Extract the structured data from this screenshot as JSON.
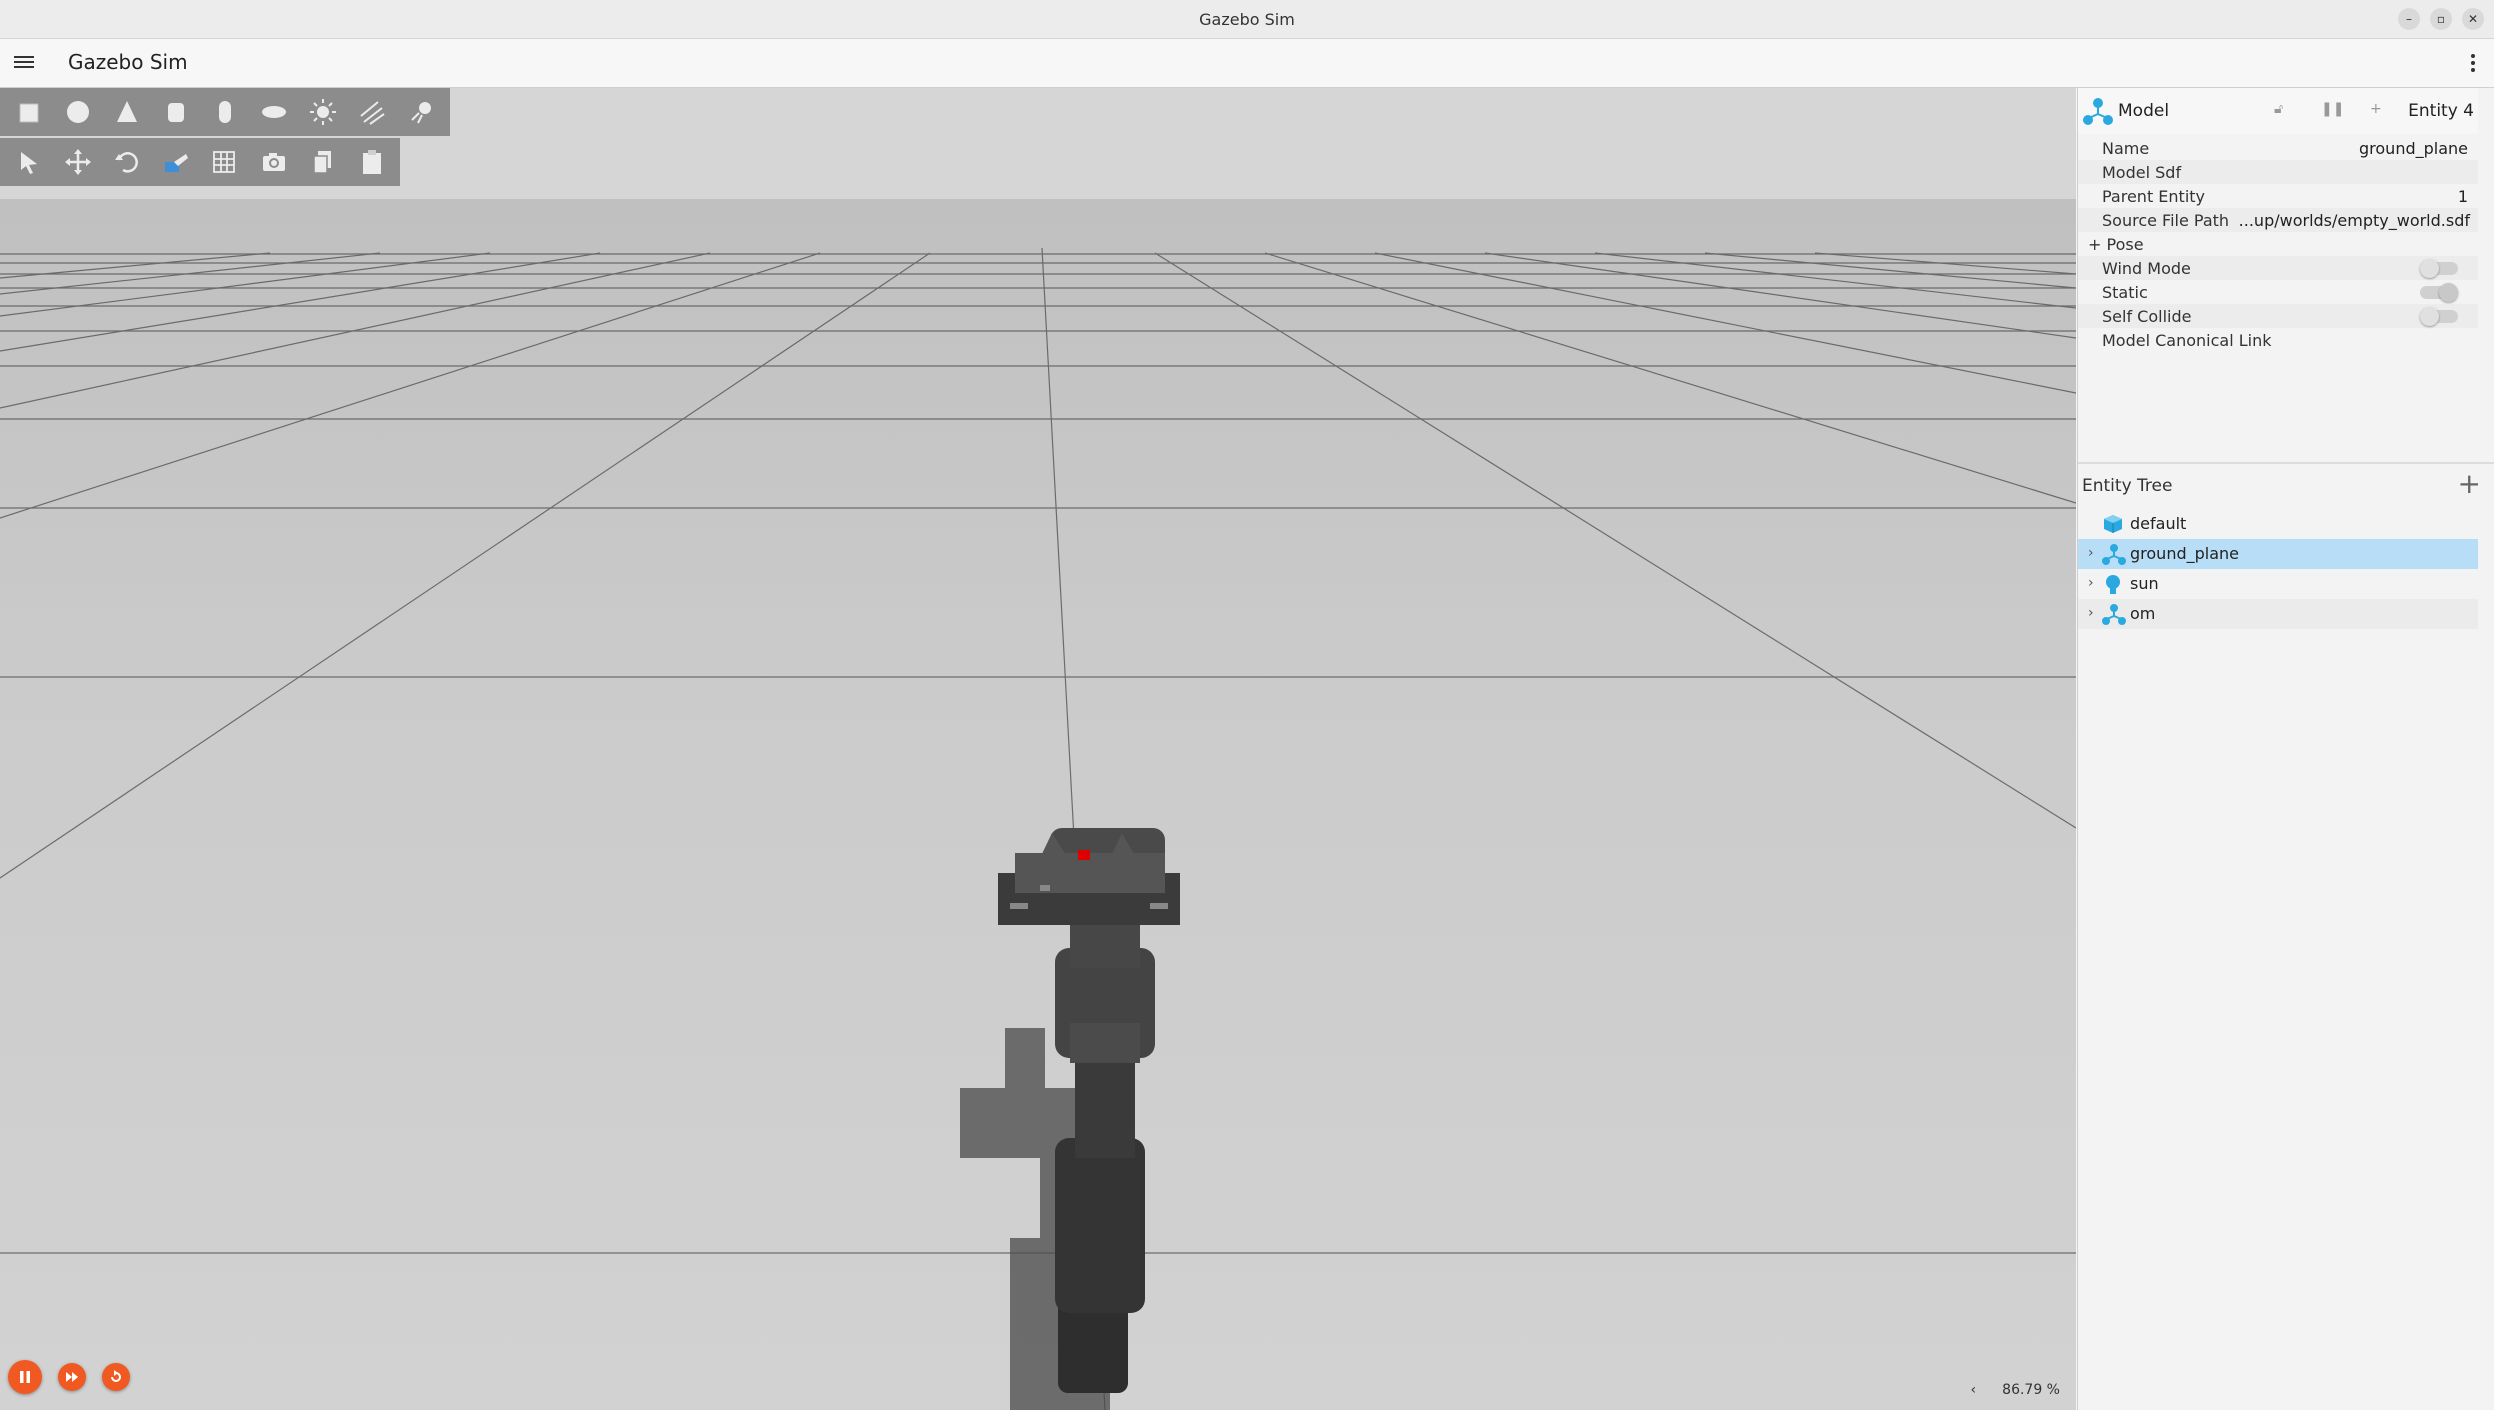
{
  "window": {
    "title": "Gazebo Sim"
  },
  "app": {
    "title": "Gazebo Sim"
  },
  "toolbar": {
    "shapes": [
      "box-icon",
      "sphere-icon",
      "cone-icon",
      "cylinder-icon",
      "capsule-icon",
      "ellipsoid-icon",
      "sun-light-icon",
      "directional-light-icon",
      "spot-light-icon"
    ],
    "tools": [
      "select-icon",
      "translate-icon",
      "rotate-icon",
      "transform-icon",
      "grid-snap-icon",
      "camera-icon",
      "copy-icon",
      "paste-icon"
    ]
  },
  "component_inspector": {
    "type": "Model",
    "entity": "Entity 4",
    "rows": [
      {
        "key": "Name",
        "value": "ground_plane"
      },
      {
        "key": "Model Sdf",
        "value": ""
      },
      {
        "key": "Parent Entity",
        "value": "1"
      },
      {
        "key": "Source File Path",
        "value": "...up/worlds/empty_world.sdf"
      },
      {
        "key": "+ Pose",
        "value": ""
      },
      {
        "key": "Wind Mode",
        "toggle": false
      },
      {
        "key": "Static",
        "toggle": true
      },
      {
        "key": "Self Collide",
        "toggle": false
      },
      {
        "key": "Model Canonical Link",
        "value": ""
      }
    ]
  },
  "entity_tree": {
    "title": "Entity Tree",
    "add_label": "+",
    "items": [
      {
        "label": "default",
        "icon": "world-icon",
        "expandable": false,
        "selected": false
      },
      {
        "label": "ground_plane",
        "icon": "model-icon",
        "expandable": true,
        "selected": true
      },
      {
        "label": "sun",
        "icon": "light-bulb-icon",
        "expandable": true,
        "selected": false
      },
      {
        "label": "om",
        "icon": "model-icon",
        "expandable": true,
        "selected": false
      }
    ]
  },
  "playback": {
    "real_time_factor": "86.79 %"
  },
  "colors": {
    "accent": "#f05a22",
    "selection": "#b7def6",
    "icon_blue": "#29a9e0"
  }
}
